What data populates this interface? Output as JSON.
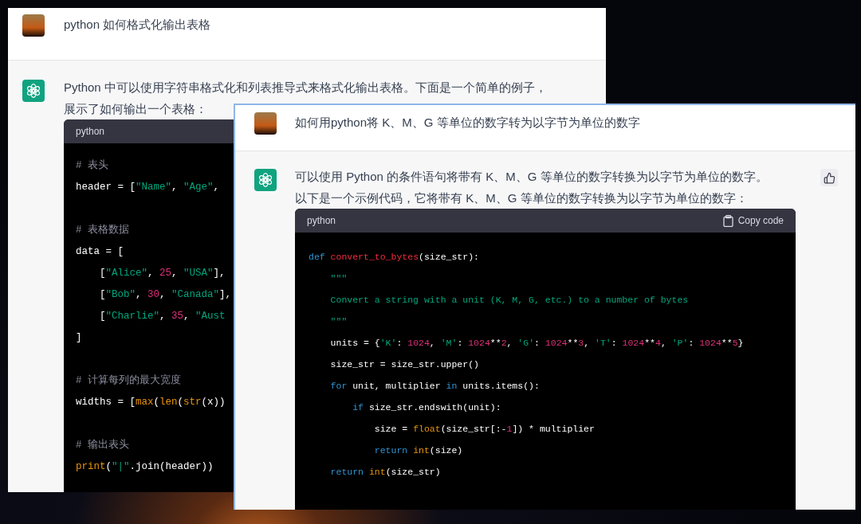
{
  "windows": [
    {
      "user_message": {
        "text": "python 如何格式化输出表格"
      },
      "assistant_message": {
        "paragraph": "Python 中可以使用字符串格式化和列表推导式来格式化输出表格。下面是一个简单的例子，展示了如何输出一个表格：",
        "code_block": {
          "language": "python",
          "lines": [
            {
              "kind": "code",
              "tokens": [
                {
                  "text": "# 表头",
                  "kind": "comment"
                }
              ]
            },
            {
              "kind": "code",
              "tokens": [
                {
                  "text": "header = [",
                  "kind": "plain"
                },
                {
                  "text": "\"Name\"",
                  "kind": "string"
                },
                {
                  "text": ", ",
                  "kind": "plain"
                },
                {
                  "text": "\"Age\"",
                  "kind": "string"
                },
                {
                  "text": ",",
                  "kind": "plain"
                }
              ]
            },
            {
              "kind": "blank"
            },
            {
              "kind": "code",
              "tokens": [
                {
                  "text": "# 表格数据",
                  "kind": "comment"
                }
              ]
            },
            {
              "kind": "code",
              "tokens": [
                {
                  "text": "data = [",
                  "kind": "plain"
                }
              ]
            },
            {
              "kind": "code",
              "tokens": [
                {
                  "text": "    [",
                  "kind": "plain"
                },
                {
                  "text": "\"Alice\"",
                  "kind": "string"
                },
                {
                  "text": ", ",
                  "kind": "plain"
                },
                {
                  "text": "25",
                  "kind": "number"
                },
                {
                  "text": ", ",
                  "kind": "plain"
                },
                {
                  "text": "\"USA\"",
                  "kind": "string"
                },
                {
                  "text": "],",
                  "kind": "plain"
                }
              ]
            },
            {
              "kind": "code",
              "tokens": [
                {
                  "text": "    [",
                  "kind": "plain"
                },
                {
                  "text": "\"Bob\"",
                  "kind": "string"
                },
                {
                  "text": ", ",
                  "kind": "plain"
                },
                {
                  "text": "30",
                  "kind": "number"
                },
                {
                  "text": ", ",
                  "kind": "plain"
                },
                {
                  "text": "\"Canada\"",
                  "kind": "string"
                },
                {
                  "text": "],",
                  "kind": "plain"
                }
              ]
            },
            {
              "kind": "code",
              "tokens": [
                {
                  "text": "    [",
                  "kind": "plain"
                },
                {
                  "text": "\"Charlie\"",
                  "kind": "string"
                },
                {
                  "text": ", ",
                  "kind": "plain"
                },
                {
                  "text": "35",
                  "kind": "number"
                },
                {
                  "text": ", ",
                  "kind": "plain"
                },
                {
                  "text": "\"Aust",
                  "kind": "string"
                }
              ]
            },
            {
              "kind": "code",
              "tokens": [
                {
                  "text": "]",
                  "kind": "plain"
                }
              ]
            },
            {
              "kind": "blank"
            },
            {
              "kind": "code",
              "tokens": [
                {
                  "text": "# 计算每列的最大宽度",
                  "kind": "comment"
                }
              ]
            },
            {
              "kind": "code",
              "tokens": [
                {
                  "text": "widths = [",
                  "kind": "plain"
                },
                {
                  "text": "max",
                  "kind": "builtin"
                },
                {
                  "text": "(",
                  "kind": "plain"
                },
                {
                  "text": "len",
                  "kind": "builtin"
                },
                {
                  "text": "(",
                  "kind": "plain"
                },
                {
                  "text": "str",
                  "kind": "builtin"
                },
                {
                  "text": "(x))",
                  "kind": "plain"
                }
              ]
            },
            {
              "kind": "blank"
            },
            {
              "kind": "code",
              "tokens": [
                {
                  "text": "# 输出表头",
                  "kind": "comment"
                }
              ]
            },
            {
              "kind": "code",
              "tokens": [
                {
                  "text": "print",
                  "kind": "builtin"
                },
                {
                  "text": "(",
                  "kind": "plain"
                },
                {
                  "text": "\"|\"",
                  "kind": "string"
                },
                {
                  "text": ".join(header))",
                  "kind": "plain"
                }
              ]
            }
          ]
        }
      }
    },
    {
      "user_message": {
        "text": "如何用python将 K、M、G 等单位的数字转为以字节为单位的数字"
      },
      "assistant_message": {
        "paragraph": "可以使用 Python 的条件语句将带有 K、M、G 等单位的数字转换为以字节为单位的数字。以下是一个示例代码，它将带有 K、M、G 等单位的数字转换为以字节为单位的数字：",
        "code_block": {
          "language": "python",
          "copy_label": "Copy code",
          "lines": [
            {
              "kind": "code",
              "tokens": [
                {
                  "text": "def ",
                  "kind": "keyword"
                },
                {
                  "text": "convert_to_bytes",
                  "kind": "function"
                },
                {
                  "text": "(size_str):",
                  "kind": "plain"
                }
              ]
            },
            {
              "kind": "code",
              "tokens": [
                {
                  "text": "    \"\"\"",
                  "kind": "string"
                }
              ]
            },
            {
              "kind": "code",
              "tokens": [
                {
                  "text": "    Convert a string with a unit (K, M, G, etc.) to a number of bytes",
                  "kind": "string"
                }
              ]
            },
            {
              "kind": "code",
              "tokens": [
                {
                  "text": "    \"\"\"",
                  "kind": "string"
                }
              ]
            },
            {
              "kind": "code",
              "tokens": [
                {
                  "text": "    units = {",
                  "kind": "plain"
                },
                {
                  "text": "'K'",
                  "kind": "string"
                },
                {
                  "text": ": ",
                  "kind": "plain"
                },
                {
                  "text": "1024",
                  "kind": "number"
                },
                {
                  "text": ", ",
                  "kind": "plain"
                },
                {
                  "text": "'M'",
                  "kind": "string"
                },
                {
                  "text": ": ",
                  "kind": "plain"
                },
                {
                  "text": "1024",
                  "kind": "number"
                },
                {
                  "text": "**",
                  "kind": "plain"
                },
                {
                  "text": "2",
                  "kind": "number"
                },
                {
                  "text": ", ",
                  "kind": "plain"
                },
                {
                  "text": "'G'",
                  "kind": "string"
                },
                {
                  "text": ": ",
                  "kind": "plain"
                },
                {
                  "text": "1024",
                  "kind": "number"
                },
                {
                  "text": "**",
                  "kind": "plain"
                },
                {
                  "text": "3",
                  "kind": "number"
                },
                {
                  "text": ", ",
                  "kind": "plain"
                },
                {
                  "text": "'T'",
                  "kind": "string"
                },
                {
                  "text": ": ",
                  "kind": "plain"
                },
                {
                  "text": "1024",
                  "kind": "number"
                },
                {
                  "text": "**",
                  "kind": "plain"
                },
                {
                  "text": "4",
                  "kind": "number"
                },
                {
                  "text": ", ",
                  "kind": "plain"
                },
                {
                  "text": "'P'",
                  "kind": "string"
                },
                {
                  "text": ": ",
                  "kind": "plain"
                },
                {
                  "text": "1024",
                  "kind": "number"
                },
                {
                  "text": "**",
                  "kind": "plain"
                },
                {
                  "text": "5",
                  "kind": "number"
                },
                {
                  "text": "}",
                  "kind": "plain"
                }
              ]
            },
            {
              "kind": "code",
              "tokens": [
                {
                  "text": "    size_str = size_str.upper()",
                  "kind": "plain"
                }
              ]
            },
            {
              "kind": "code",
              "tokens": [
                {
                  "text": "    for",
                  "kind": "keyword"
                },
                {
                  "text": " unit, multiplier ",
                  "kind": "plain"
                },
                {
                  "text": "in",
                  "kind": "keyword"
                },
                {
                  "text": " units.items():",
                  "kind": "plain"
                }
              ]
            },
            {
              "kind": "code",
              "tokens": [
                {
                  "text": "        if",
                  "kind": "keyword"
                },
                {
                  "text": " size_str.endswith(unit):",
                  "kind": "plain"
                }
              ]
            },
            {
              "kind": "code",
              "tokens": [
                {
                  "text": "            size = ",
                  "kind": "plain"
                },
                {
                  "text": "float",
                  "kind": "builtin"
                },
                {
                  "text": "(size_str[:-",
                  "kind": "plain"
                },
                {
                  "text": "1",
                  "kind": "number"
                },
                {
                  "text": "]) * multiplier",
                  "kind": "plain"
                }
              ]
            },
            {
              "kind": "code",
              "tokens": [
                {
                  "text": "            return",
                  "kind": "keyword"
                },
                {
                  "text": " int",
                  "kind": "builtin"
                },
                {
                  "text": "(size)",
                  "kind": "plain"
                }
              ]
            },
            {
              "kind": "code",
              "tokens": [
                {
                  "text": "    return",
                  "kind": "keyword"
                },
                {
                  "text": " int",
                  "kind": "builtin"
                },
                {
                  "text": "(size_str)",
                  "kind": "plain"
                }
              ]
            }
          ]
        }
      }
    }
  ]
}
